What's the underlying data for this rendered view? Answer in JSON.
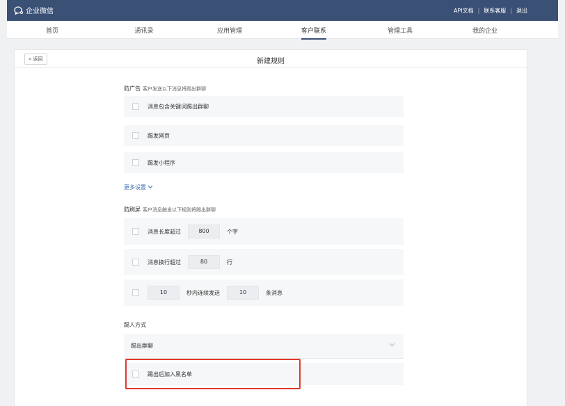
{
  "app": {
    "name": "企业微信",
    "top_links": [
      "API文档",
      "联系客服",
      "退出"
    ]
  },
  "nav": {
    "tabs": [
      {
        "label": "首页",
        "active": false
      },
      {
        "label": "通讯录",
        "active": false
      },
      {
        "label": "应用管理",
        "active": false
      },
      {
        "label": "客户联系",
        "active": true
      },
      {
        "label": "管理工具",
        "active": false
      },
      {
        "label": "我的企业",
        "active": false
      }
    ]
  },
  "page": {
    "back_label": "« 返回",
    "title": "新建规则"
  },
  "anti_ad": {
    "title": "防广告",
    "subtitle": "客户发送以下消息将踢出群聊",
    "options": [
      {
        "label": "消息包含关键词踢出群聊",
        "checked": false
      },
      {
        "label": "踢发网页",
        "checked": false
      },
      {
        "label": "踢发小程序",
        "checked": false
      }
    ],
    "more_label": "更多设置"
  },
  "anti_spam": {
    "title": "防刷屏",
    "subtitle": "客户消息触发以下规则将踢出群聊",
    "length": {
      "prefix": "消息长度超过",
      "value": "800",
      "suffix": "个字"
    },
    "lines": {
      "prefix": "消息换行超过",
      "value": "80",
      "suffix": "行"
    },
    "frequency": {
      "seconds": "10",
      "middle": "秒内连续发送",
      "count": "10",
      "suffix": "条消息"
    }
  },
  "kick": {
    "title": "踢人方式",
    "selected": "踢出群聊",
    "blacklist_label": "踢出后加入黑名单",
    "blacklist_checked": false
  },
  "colors": {
    "header_bg": "#3a5075",
    "highlight_border": "#e13a2e",
    "link": "#3d6fb5"
  }
}
